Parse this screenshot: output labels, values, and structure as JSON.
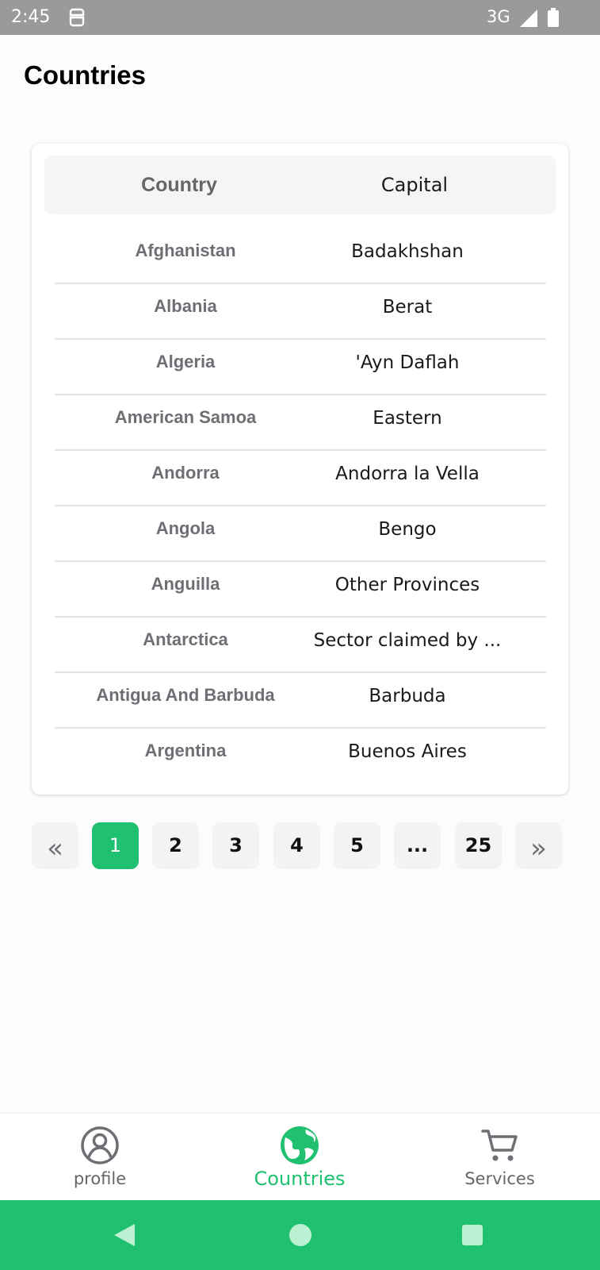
{
  "status_bar": {
    "time": "2:45",
    "network": "3G"
  },
  "page": {
    "title": "Countries"
  },
  "table": {
    "headers": {
      "country": "Country",
      "capital": "Capital"
    },
    "rows": [
      {
        "country": "Afghanistan",
        "capital": "Badakhshan"
      },
      {
        "country": "Albania",
        "capital": "Berat"
      },
      {
        "country": "Algeria",
        "capital": "'Ayn Daflah"
      },
      {
        "country": "American Samoa",
        "capital": "Eastern"
      },
      {
        "country": "Andorra",
        "capital": "Andorra la Vella"
      },
      {
        "country": "Angola",
        "capital": "Bengo"
      },
      {
        "country": "Anguilla",
        "capital": "Other Provinces"
      },
      {
        "country": "Antarctica",
        "capital": "Sector claimed by ..."
      },
      {
        "country": "Antigua And Barbuda",
        "capital": "Barbuda"
      },
      {
        "country": "Argentina",
        "capital": "Buenos Aires"
      }
    ]
  },
  "pagination": {
    "first": "«",
    "pages": [
      "1",
      "2",
      "3",
      "4",
      "5",
      "...",
      "25"
    ],
    "active": "1",
    "last": "»"
  },
  "bottom_nav": {
    "items": [
      {
        "label": "profile",
        "icon": "profile-icon"
      },
      {
        "label": "Countries",
        "icon": "globe-icon",
        "active": true
      },
      {
        "label": "Services",
        "icon": "cart-icon"
      }
    ]
  },
  "colors": {
    "accent": "#1fc06f",
    "status_bar": "#9a9a9a",
    "text_muted": "#6e6e74"
  }
}
